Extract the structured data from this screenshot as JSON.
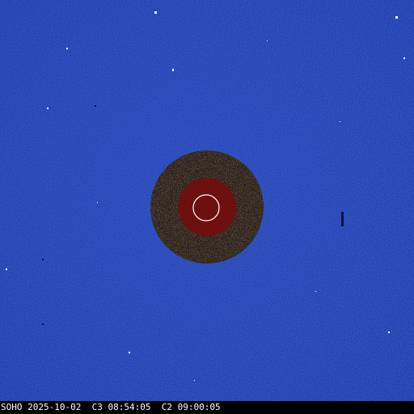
{
  "caption": {
    "mission": "SOHO",
    "date": "2025-10-02",
    "c3_label": "C3",
    "c3_time": "08:54:05",
    "c2_label": "C2",
    "c2_time": "09:00:05"
  },
  "colors": {
    "background_blue": "#2240b8",
    "occulter_ring": "#2a2018",
    "occulting_disk": "#6e1010",
    "sun_outline": "#ffffff",
    "footer_bg": "#000000",
    "footer_text": "#ffffff"
  },
  "icons": {
    "sun_outline": "sun-circle-icon"
  }
}
